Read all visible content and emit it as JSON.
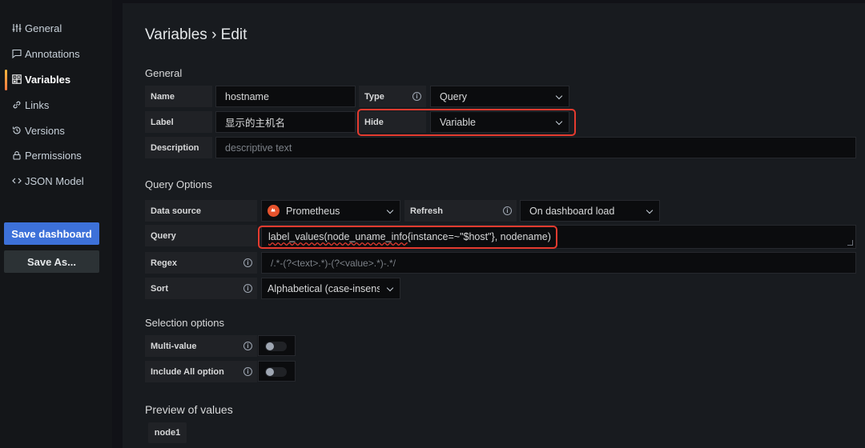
{
  "sidebar": {
    "items": [
      {
        "label": "General",
        "icon": "sliders-icon"
      },
      {
        "label": "Annotations",
        "icon": "comment-icon"
      },
      {
        "label": "Variables",
        "icon": "calculator-icon",
        "active": true
      },
      {
        "label": "Links",
        "icon": "link-icon"
      },
      {
        "label": "Versions",
        "icon": "history-icon"
      },
      {
        "label": "Permissions",
        "icon": "lock-icon"
      },
      {
        "label": "JSON Model",
        "icon": "code-icon"
      }
    ],
    "save_dashboard": "Save dashboard",
    "save_as": "Save As..."
  },
  "page": {
    "title": "Variables › Edit"
  },
  "general": {
    "title": "General",
    "name_label": "Name",
    "name_value": "hostname",
    "type_label": "Type",
    "type_value": "Query",
    "label_label": "Label",
    "label_value": "显示的主机名",
    "hide_label": "Hide",
    "hide_value": "Variable",
    "description_label": "Description",
    "description_placeholder": "descriptive text"
  },
  "query_options": {
    "title": "Query Options",
    "datasource_label": "Data source",
    "datasource_value": "Prometheus",
    "refresh_label": "Refresh",
    "refresh_value": "On dashboard load",
    "query_label": "Query",
    "query_value_underlined": "label_values(node_uname_info",
    "query_value_rest": "{instance=~\"$host\"}, nodename)",
    "regex_label": "Regex",
    "regex_placeholder": "/.*-(?<text>.*)-(?<value>.*)-.*/",
    "sort_label": "Sort",
    "sort_value": "Alphabetical (case-insens"
  },
  "selection_options": {
    "title": "Selection options",
    "multi_value_label": "Multi-value",
    "multi_value_on": false,
    "include_all_label": "Include All option",
    "include_all_on": false
  },
  "preview": {
    "title": "Preview of values",
    "values": [
      "node1"
    ]
  },
  "colors": {
    "primary": "#3d71d9",
    "highlight": "#e53b2f",
    "prometheus": "#e6522c"
  }
}
